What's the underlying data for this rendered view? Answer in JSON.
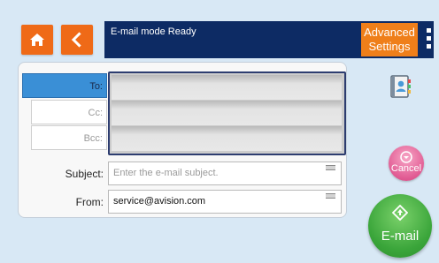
{
  "header": {
    "status_text": "E-mail mode  Ready",
    "advanced_settings_label": "Advanced\nSettings"
  },
  "recipients": {
    "to_label": "To:",
    "cc_label": "Cc:",
    "bcc_label": "Bcc:",
    "to_value": "",
    "cc_value": "",
    "bcc_value": ""
  },
  "subject": {
    "label": "Subject:",
    "placeholder": "Enter the e-mail subject."
  },
  "from": {
    "label": "From:",
    "value": "service@avision.com"
  },
  "actions": {
    "cancel_label": "Cancel",
    "email_label": "E-mail"
  },
  "icons": {
    "home": "home-icon",
    "back": "chevron-left-icon",
    "menu": "menu-icon",
    "address_book": "address-book-icon",
    "cancel": "cancel-icon",
    "email": "email-icon"
  },
  "colors": {
    "accent_orange": "#ef6a17",
    "header_navy": "#0d2b64",
    "to_label_blue": "#3a8fd6",
    "cancel_pink": "#e15b93",
    "email_green": "#3aa53a"
  }
}
